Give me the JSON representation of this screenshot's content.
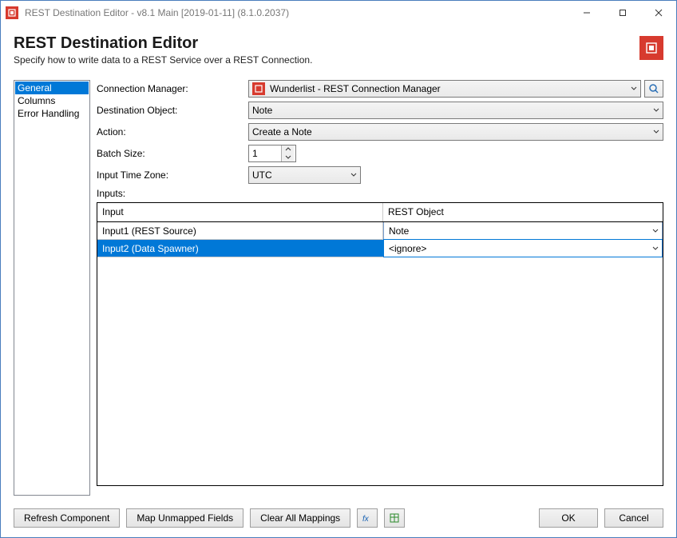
{
  "window": {
    "title": "REST Destination Editor - v8.1 Main [2019-01-11] (8.1.0.2037)"
  },
  "header": {
    "title": "REST Destination Editor",
    "subtitle": "Specify how to write data to a REST Service over a REST Connection."
  },
  "nav": {
    "items": [
      "General",
      "Columns",
      "Error Handling"
    ],
    "selected": 0
  },
  "form": {
    "connection_manager_label": "Connection Manager:",
    "connection_manager_value": "Wunderlist - REST Connection Manager",
    "destination_object_label": "Destination Object:",
    "destination_object_value": "Note",
    "action_label": "Action:",
    "action_value": "Create a Note",
    "batch_size_label": "Batch Size:",
    "batch_size_value": "1",
    "input_tz_label": "Input Time Zone:",
    "input_tz_value": "UTC",
    "inputs_label": "Inputs:"
  },
  "grid": {
    "columns": [
      "Input",
      "REST Object"
    ],
    "rows": [
      {
        "input": "Input1 (REST Source)",
        "rest_object": "Note",
        "selected": false
      },
      {
        "input": "Input2 (Data Spawner)",
        "rest_object": "<ignore>",
        "selected": true
      }
    ]
  },
  "footer": {
    "refresh": "Refresh Component",
    "map_unmapped": "Map Unmapped Fields",
    "clear_mappings": "Clear All Mappings",
    "ok": "OK",
    "cancel": "Cancel"
  }
}
